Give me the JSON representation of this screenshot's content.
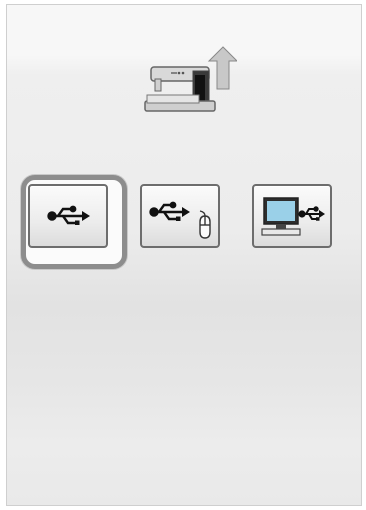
{
  "screen": {
    "header_icon": "sewing-machine-upload-icon",
    "buttons": [
      {
        "id": "usb",
        "icon": "usb-icon",
        "selected": true
      },
      {
        "id": "usb-mouse",
        "icon": "usb-mouse-icon",
        "selected": false
      },
      {
        "id": "usb-pc",
        "icon": "pc-usb-icon",
        "selected": false
      }
    ]
  },
  "colors": {
    "selection_ring": "#8d8d8d",
    "button_border": "#6d6d6d"
  }
}
